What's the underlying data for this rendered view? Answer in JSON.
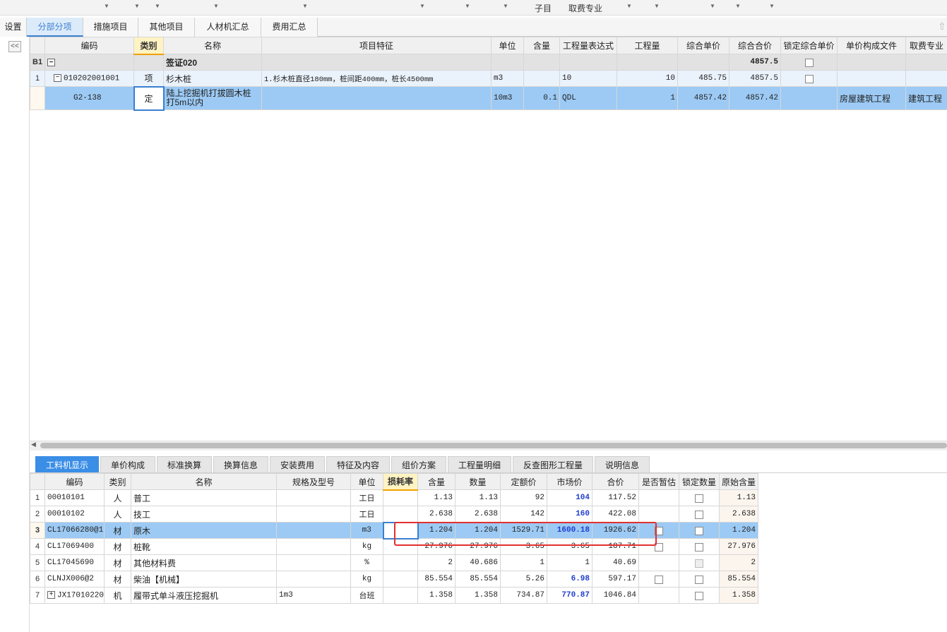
{
  "top_strip": {
    "label_zimu": "子目",
    "label_fee": "取费专业"
  },
  "tabs": [
    {
      "label": "设置"
    },
    {
      "label": "分部分项"
    },
    {
      "label": "措施项目"
    },
    {
      "label": "其他项目"
    },
    {
      "label": "人材机汇总"
    },
    {
      "label": "费用汇总"
    }
  ],
  "collapse_glyph": "<<",
  "upper_grid": {
    "headers": [
      "编码",
      "类别",
      "名称",
      "项目特征",
      "单位",
      "含量",
      "工程量表达式",
      "工程量",
      "综合单价",
      "综合合价",
      "锁定综合单价",
      "单价构成文件",
      "取费专业"
    ],
    "rows": [
      {
        "num": "B1",
        "code": "",
        "type": "",
        "name": "签证020",
        "feature": "",
        "unit": "",
        "qty_ratio": "",
        "expr": "",
        "qty": "",
        "unit_price": "",
        "total": "4857.5",
        "file": "",
        "fee": ""
      },
      {
        "num": "1",
        "code": "010202001001",
        "type": "项",
        "name": "杉木桩",
        "feature": "1.杉木桩直径180mm，桩间距400mm，桩长4500mm",
        "unit": "m3",
        "qty_ratio": "",
        "expr": "10",
        "qty": "10",
        "unit_price": "485.75",
        "total": "4857.5",
        "file": "",
        "fee": ""
      },
      {
        "num": "",
        "code": "G2-138",
        "type": "定",
        "name": "陆上挖掘机打拔圆木桩打5m以内",
        "feature": "",
        "unit": "10m3",
        "qty_ratio": "0.1",
        "expr": "QDL",
        "qty": "1",
        "unit_price": "4857.42",
        "total": "4857.42",
        "file": "房屋建筑工程",
        "fee": "建筑工程"
      }
    ]
  },
  "bottom_tabs": [
    "工料机显示",
    "单价构成",
    "标准换算",
    "换算信息",
    "安装费用",
    "特征及内容",
    "组价方案",
    "工程量明细",
    "反查图形工程量",
    "说明信息"
  ],
  "lower_grid": {
    "headers": [
      "编码",
      "类别",
      "名称",
      "规格及型号",
      "单位",
      "损耗率",
      "含量",
      "数量",
      "定额价",
      "市场价",
      "合价",
      "是否暂估",
      "锁定数量",
      "原始含量"
    ],
    "rows": [
      {
        "num": "1",
        "code": "00010101",
        "type": "人",
        "name": "普工",
        "spec": "",
        "unit": "工日",
        "loss": "",
        "ratio": "1.13",
        "qty": "1.13",
        "base": "92",
        "market": "104",
        "total": "117.52",
        "est": "none",
        "lock": "box",
        "orig": "1.13",
        "market_blue": true
      },
      {
        "num": "2",
        "code": "00010102",
        "type": "人",
        "name": "技工",
        "spec": "",
        "unit": "工日",
        "loss": "",
        "ratio": "2.638",
        "qty": "2.638",
        "base": "142",
        "market": "160",
        "total": "422.08",
        "est": "none",
        "lock": "box",
        "orig": "2.638",
        "market_blue": true
      },
      {
        "num": "3",
        "code": "CL17066280@1",
        "type": "材",
        "name": "原木",
        "spec": "",
        "unit": "m3",
        "loss": "",
        "ratio": "1.204",
        "qty": "1.204",
        "base": "1529.71",
        "market": "1600.18",
        "total": "1926.62",
        "est": "box",
        "lock": "box",
        "orig": "1.204",
        "market_blue": true
      },
      {
        "num": "4",
        "code": "CL17069400",
        "type": "材",
        "name": "桩靴",
        "spec": "",
        "unit": "kg",
        "loss": "",
        "ratio": "27.976",
        "qty": "27.976",
        "base": "3.65",
        "market": "3.65",
        "total": "187.71",
        "est": "box",
        "lock": "box",
        "orig": "27.976",
        "market_blue": false
      },
      {
        "num": "5",
        "code": "CL17045690",
        "type": "材",
        "name": "其他材料费",
        "spec": "",
        "unit": "%",
        "loss": "",
        "ratio": "2",
        "qty": "40.686",
        "base": "1",
        "market": "1",
        "total": "40.69",
        "est": "none",
        "lock": "dis",
        "orig": "2",
        "market_blue": false
      },
      {
        "num": "6",
        "code": "CLNJX006@2",
        "type": "材",
        "name": "柴油【机械】",
        "spec": "",
        "unit": "kg",
        "loss": "",
        "ratio": "85.554",
        "qty": "85.554",
        "base": "5.26",
        "market": "6.98",
        "total": "597.17",
        "est": "box",
        "lock": "box",
        "orig": "85.554",
        "market_blue": true
      },
      {
        "num": "7",
        "code": "JX17010220",
        "type": "机",
        "name": "履带式单斗液压挖掘机",
        "spec": "1m3",
        "unit": "台班",
        "loss": "",
        "ratio": "1.358",
        "qty": "1.358",
        "base": "734.87",
        "market": "770.87",
        "total": "1046.84",
        "est": "none",
        "lock": "box",
        "orig": "1.358",
        "market_blue": true
      }
    ]
  },
  "icons": {
    "dropdown": "caret-down",
    "tree_collapse": "minus-box",
    "tree_expand": "plus-box",
    "scroll_up": "arrow-up"
  },
  "colors": {
    "accent": "#3a8ee6",
    "selected_row": "#9ccaf4",
    "highlight_box": "#e23030",
    "market_price": "#1f3fd0"
  }
}
